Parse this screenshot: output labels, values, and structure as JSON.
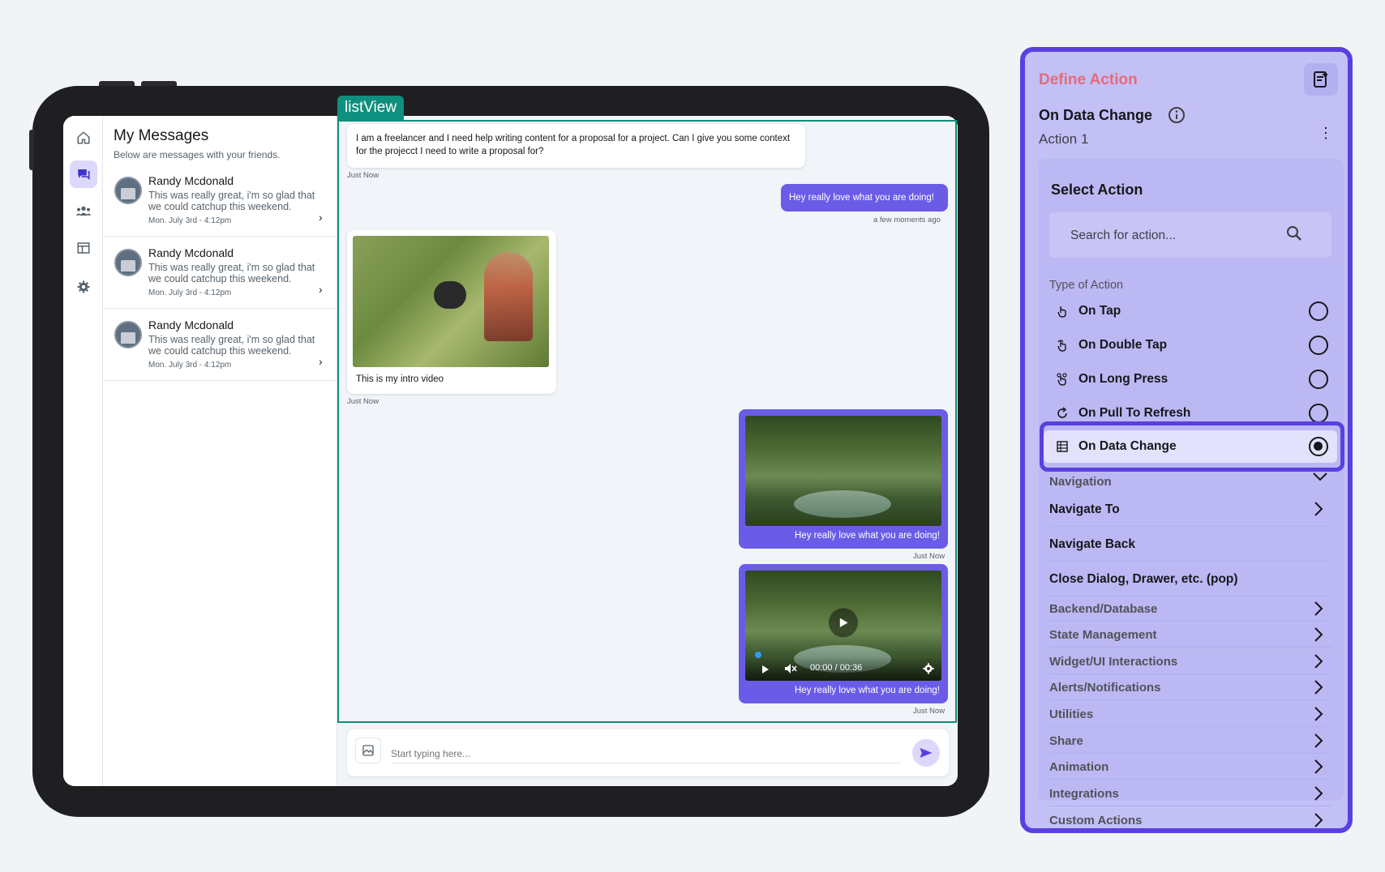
{
  "listview_tag": "listView",
  "rail": [
    "home-icon",
    "chat-icon",
    "group-icon",
    "table-icon",
    "settings-icon"
  ],
  "messages": {
    "title": "My Messages",
    "subtitle": "Below are messages with your friends.",
    "items": [
      {
        "name": "Randy Mcdonald",
        "text": "This was really great, i'm so glad that we could catchup this weekend.",
        "date": "Mon. July 3rd - 4:12pm"
      },
      {
        "name": "Randy Mcdonald",
        "text": "This was really great, i'm so glad that we could catchup this weekend.",
        "date": "Mon. July 3rd - 4:12pm"
      },
      {
        "name": "Randy Mcdonald",
        "text": "This was really great, i'm so glad that we could catchup this weekend.",
        "date": "Mon. July 3rd - 4:12pm"
      }
    ]
  },
  "chat": {
    "m1_text": "I am a freelancer and I need help writing content for a proposal for a project. Can I give you some context for the projecct I need to write a proposal for?",
    "m1_time": "Just Now",
    "m2_text": "Hey really love what you are doing!",
    "m2_time": "a few moments ago",
    "m3_caption": "This is my intro video",
    "m3_time": "Just Now",
    "m4_caption": "Hey really love what you are doing!",
    "m4_time": "Just Now",
    "m5_caption": "Hey really love what you are doing!",
    "m5_time": "Just Now",
    "video_time": "00:00 / 00:36",
    "input_placeholder": "Start typing here..."
  },
  "panel": {
    "title": "Define Action",
    "event": "On Data Change",
    "action_name": "Action 1",
    "select_title": "Select Action",
    "search_placeholder": "Search for action...",
    "type_label": "Type of Action",
    "types": [
      {
        "label": "On Tap",
        "icon": "tap-icon",
        "selected": false
      },
      {
        "label": "On Double Tap",
        "icon": "double-tap-icon",
        "selected": false
      },
      {
        "label": "On Long Press",
        "icon": "long-press-icon",
        "selected": false
      },
      {
        "label": "On Pull To Refresh",
        "icon": "refresh-icon",
        "selected": false
      },
      {
        "label": "On Data Change",
        "icon": "data-icon",
        "selected": true
      }
    ],
    "navigation_label": "Navigation",
    "navigation_items": [
      "Navigate To",
      "Navigate Back",
      "Close Dialog, Drawer, etc. (pop)"
    ],
    "categories": [
      "Backend/Database",
      "State Management",
      "Widget/UI Interactions",
      "Alerts/Notifications",
      "Utilities",
      "Share",
      "Animation",
      "Integrations",
      "Custom Actions"
    ],
    "accent_color": "#5a40e0",
    "title_color": "#e46c78"
  }
}
